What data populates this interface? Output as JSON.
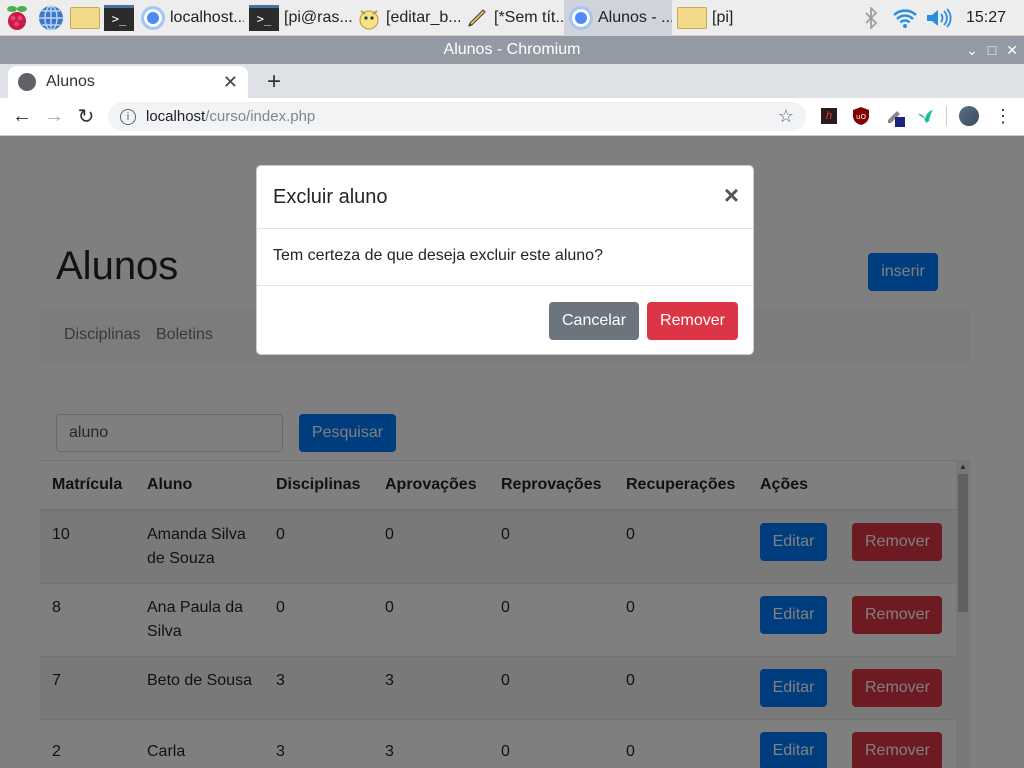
{
  "taskbar": {
    "tasks": [
      {
        "label": "localhost..."
      },
      {
        "label": "[pi@ras..."
      },
      {
        "label": "[editar_b..."
      },
      {
        "label": "[*Sem tít..."
      },
      {
        "label": "Alunos - ..."
      },
      {
        "label": "[pi]"
      }
    ],
    "clock": "15:27"
  },
  "window": {
    "title": "Alunos - Chromium"
  },
  "browser": {
    "tab_label": "Alunos",
    "url_host": "localhost",
    "url_path": "/curso/index.php"
  },
  "page": {
    "title": "Alunos",
    "insert_label": "inserir",
    "nav": [
      "Disciplinas",
      "Boletins"
    ],
    "search_value": "aluno",
    "search_button": "Pesquisar",
    "table": {
      "headers": [
        "Matrícula",
        "Aluno",
        "Disciplinas",
        "Aprovações",
        "Reprovações",
        "Recuperações",
        "Ações"
      ],
      "rows": [
        {
          "matricula": "10",
          "aluno": "Amanda Silva de Souza",
          "disciplinas": "0",
          "aprovacoes": "0",
          "reprovacoes": "0",
          "recuperacoes": "0"
        },
        {
          "matricula": "8",
          "aluno": "Ana Paula da Silva",
          "disciplinas": "0",
          "aprovacoes": "0",
          "reprovacoes": "0",
          "recuperacoes": "0"
        },
        {
          "matricula": "7",
          "aluno": "Beto de Sousa",
          "disciplinas": "3",
          "aprovacoes": "3",
          "reprovacoes": "0",
          "recuperacoes": "0"
        },
        {
          "matricula": "2",
          "aluno": "Carla Morgado",
          "disciplinas": "3",
          "aprovacoes": "3",
          "reprovacoes": "0",
          "recuperacoes": "0"
        }
      ],
      "edit_label": "Editar",
      "remove_label": "Remover"
    }
  },
  "modal": {
    "title": "Excluir aluno",
    "close": "×",
    "body": "Tem certeza de que deseja excluir este aluno?",
    "cancel": "Cancelar",
    "confirm": "Remover"
  },
  "colors": {
    "primary": "#007bff",
    "danger": "#dc3545",
    "secondary": "#6c757d"
  }
}
